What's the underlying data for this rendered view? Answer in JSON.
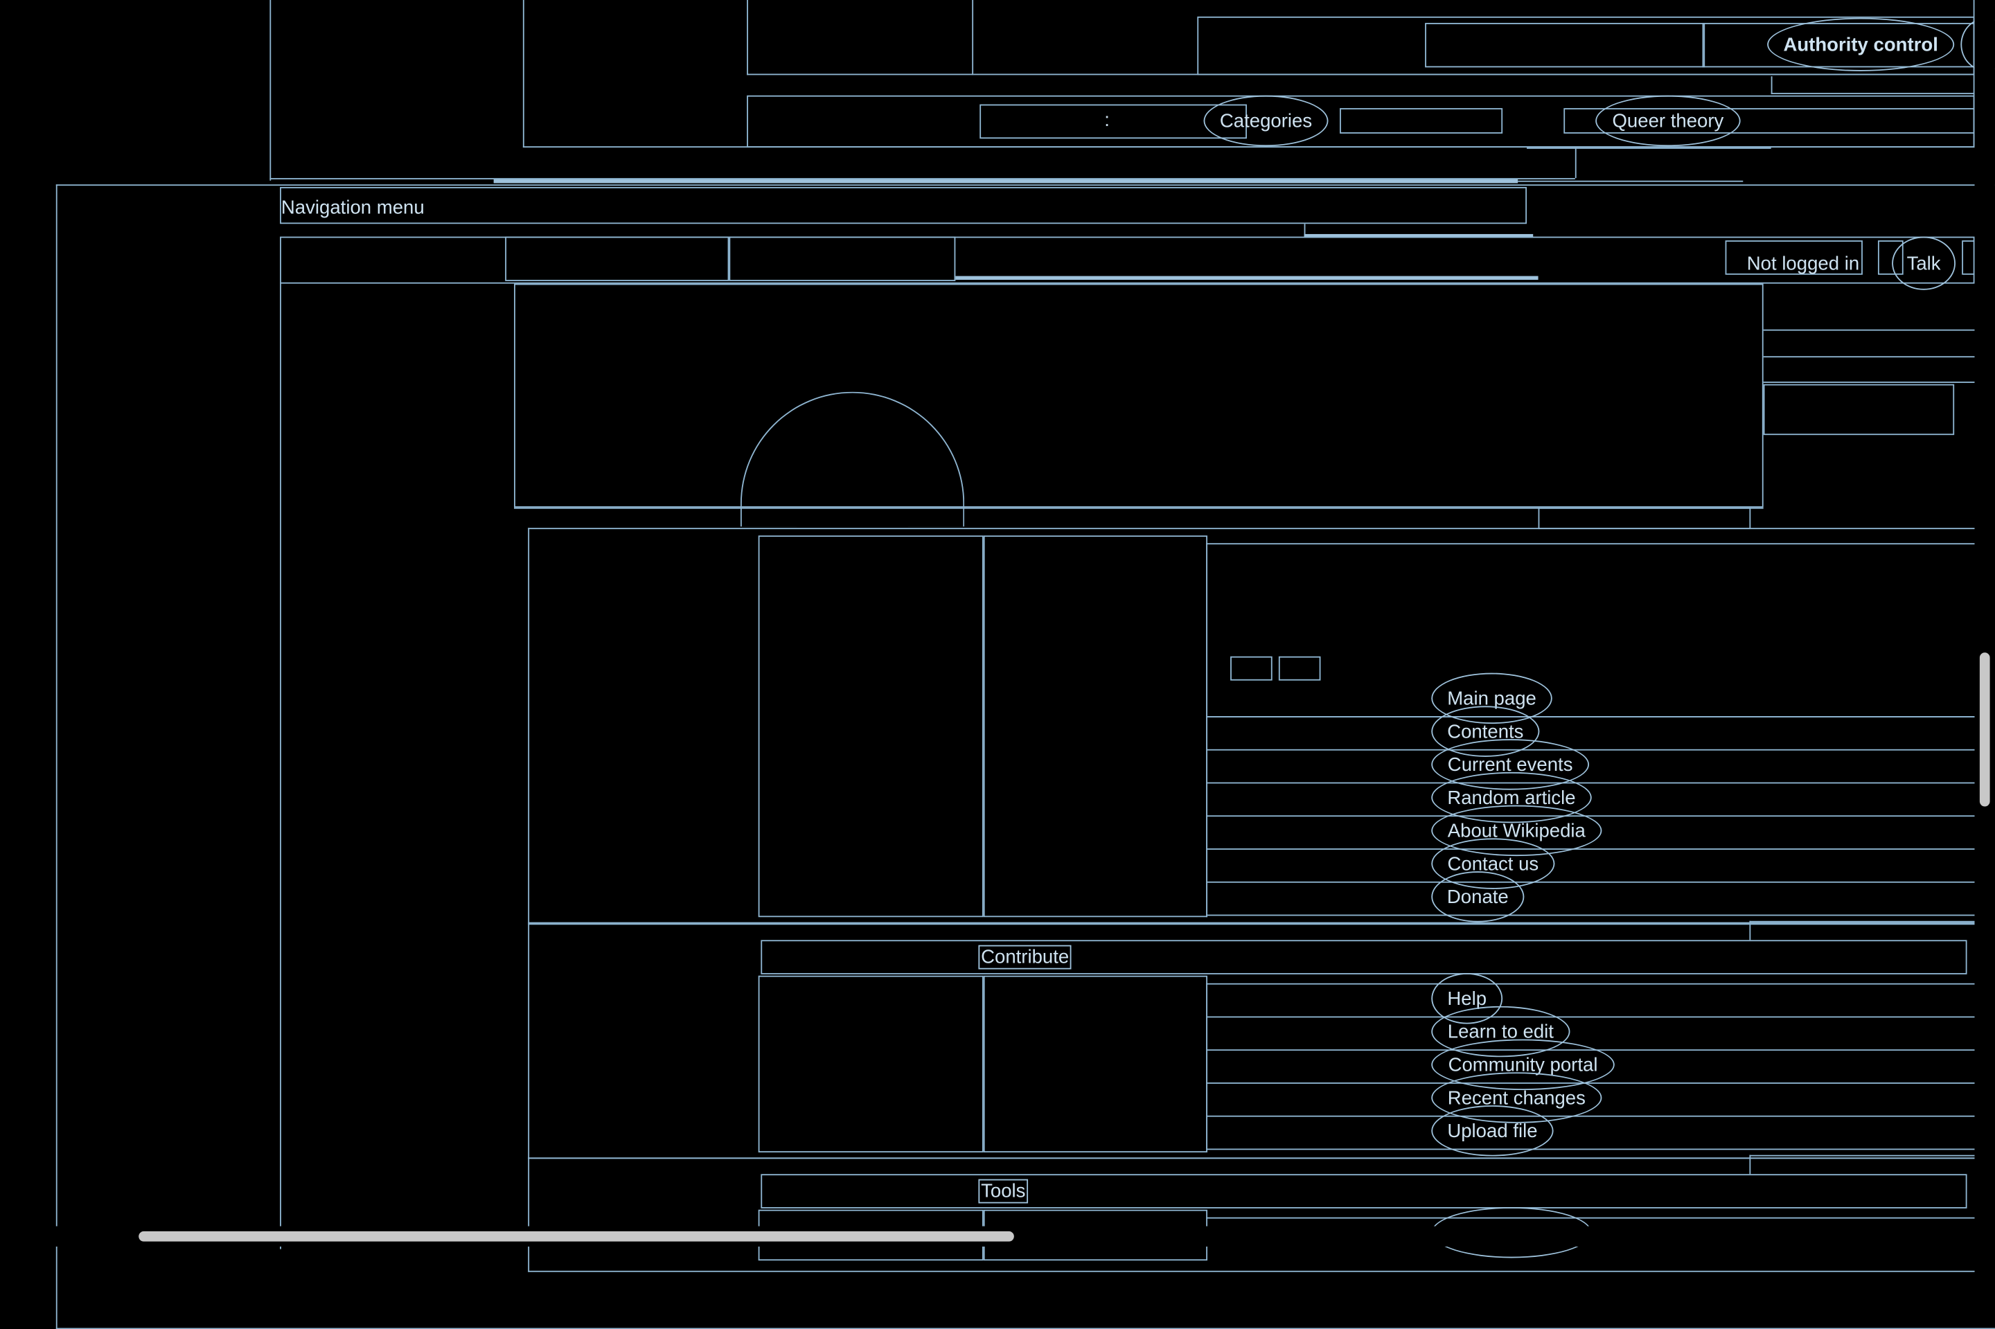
{
  "top_links": {
    "authority_control": "Authority control",
    "colon": ":",
    "categories": "Categories",
    "queer_theory": "Queer theory"
  },
  "nav": {
    "heading": "Navigation menu",
    "not_logged_in": "Not logged in",
    "talk": "Talk"
  },
  "sidebar": {
    "navigation": [
      "Main page",
      "Contents",
      "Current events",
      "Random article",
      "About Wikipedia",
      "Contact us",
      "Donate"
    ],
    "contribute_heading": "Contribute",
    "contribute": [
      "Help",
      "Learn to edit",
      "Community portal",
      "Recent changes",
      "Upload file"
    ],
    "tools_heading": "Tools"
  },
  "colors": {
    "background": "#000000",
    "outline": "#8fb6d2",
    "text": "#cfe3f1",
    "scrollbar": "#c8c8c8"
  }
}
